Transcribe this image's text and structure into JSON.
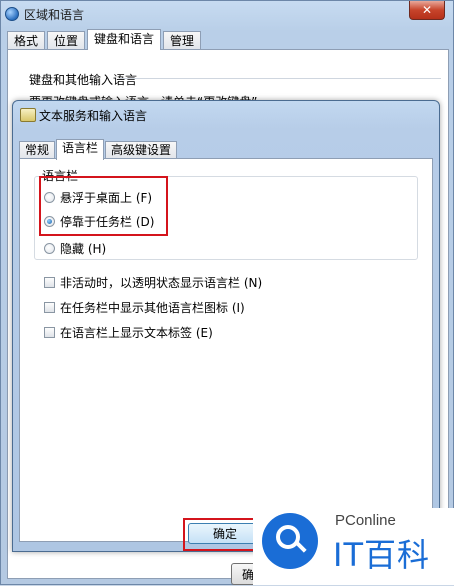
{
  "outer": {
    "title": "区域和语言",
    "close_glyph": "✕",
    "tabs": [
      {
        "label": "格式",
        "active": false
      },
      {
        "label": "位置",
        "active": false
      },
      {
        "label": "键盘和语言",
        "active": true
      },
      {
        "label": "管理",
        "active": false
      }
    ],
    "group_label": "键盘和其他输入语言",
    "description": "要更改键盘或输入语言，请单击“更改键盘”",
    "bottom_button": "确"
  },
  "dialog": {
    "title": "文本服务和输入语言",
    "tabs": [
      {
        "label": "常规",
        "active": false
      },
      {
        "label": "语言栏",
        "active": true
      },
      {
        "label": "高级键设置",
        "active": false
      }
    ],
    "group_label": "语言栏",
    "radios": [
      {
        "label": "悬浮于桌面上 (F)",
        "checked": false
      },
      {
        "label": "停靠于任务栏 (D)",
        "checked": true
      },
      {
        "label": "隐藏 (H)",
        "checked": false
      }
    ],
    "checkboxes": [
      {
        "label": "非活动时，以透明状态显示语言栏 (N)",
        "checked": false
      },
      {
        "label": "在任务栏中显示其他语言栏图标 (I)",
        "checked": false
      },
      {
        "label": "在语言栏上显示文本标签 (E)",
        "checked": false
      }
    ],
    "ok_button": "确定"
  },
  "watermark": {
    "top_text": "PConline",
    "main_text": "IT百科",
    "color": "#1a6dd6"
  },
  "highlight_color": "#d4141c"
}
